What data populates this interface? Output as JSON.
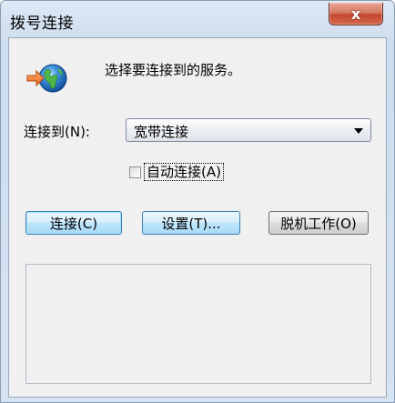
{
  "window": {
    "title": "拨号连接",
    "close_label": "x"
  },
  "main": {
    "prompt": "选择要连接到的服务。",
    "icon": "network-globe-icon",
    "connect_to_label": "连接到(N):",
    "connection_selected": "宽带连接",
    "auto_connect_label": "自动连接(A)",
    "auto_connect_checked": false
  },
  "buttons": {
    "connect": "连接(C)",
    "settings": "设置(T)...",
    "offline": "脱机工作(O)"
  },
  "colors": {
    "accent": "#3c7fb1",
    "close": "#c4492f"
  }
}
